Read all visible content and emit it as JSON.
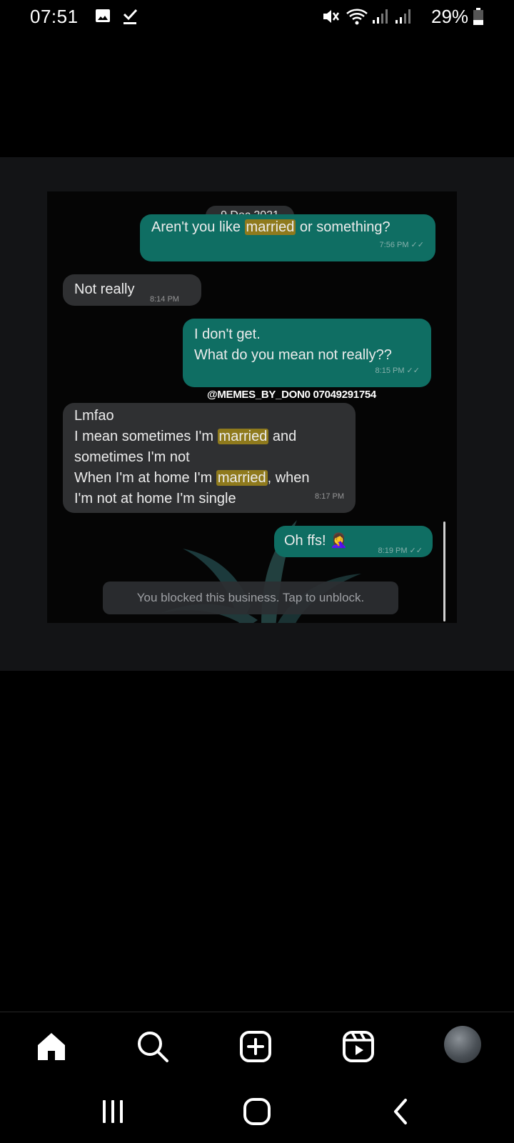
{
  "status_bar": {
    "time": "07:51",
    "battery": "29%",
    "icons": [
      "image-icon",
      "download-done-icon",
      "mute-icon",
      "wifi-icon",
      "signal-icon",
      "signal-icon",
      "battery-icon"
    ]
  },
  "post": {
    "chat": {
      "date": "9 Dec 2021",
      "messages": [
        {
          "dir": "out",
          "parts": [
            "Aren't you like ",
            "married",
            " or something?"
          ],
          "time": "7:56 PM ✓✓"
        },
        {
          "dir": "in",
          "text": "Not really",
          "time": "8:14 PM"
        },
        {
          "dir": "out",
          "lines": [
            "I don't get.",
            "What do you mean not really??"
          ],
          "time": "8:15 PM ✓✓"
        },
        {
          "dir": "in",
          "lines": [
            "Lmfao",
            "I mean sometimes I'm ",
            "married",
            " and",
            "sometimes I'm not",
            "When I'm at home I'm ",
            "married",
            ", when",
            "I'm not at home I'm single"
          ],
          "time": "8:17 PM"
        },
        {
          "dir": "out",
          "text": "Oh ffs! 🤦‍♀️",
          "time": "8:19 PM ✓✓"
        }
      ],
      "watermark": "@MEMES_BY_DON0 07049291754",
      "blocked_notice": "You blocked this business. Tap to unblock."
    }
  },
  "bottom_nav": {
    "items": [
      "home-icon",
      "search-icon",
      "create-icon",
      "reels-icon",
      "profile-avatar"
    ],
    "active": "home-icon"
  },
  "system_nav": {
    "items": [
      "recent-apps-icon",
      "home-button-icon",
      "back-icon"
    ]
  },
  "colors": {
    "background": "#000000",
    "media_frame": "#131416",
    "outgoing_bubble": "#0f6e63",
    "incoming_bubble": "#2f3032",
    "highlight": "#8f7a1d"
  }
}
